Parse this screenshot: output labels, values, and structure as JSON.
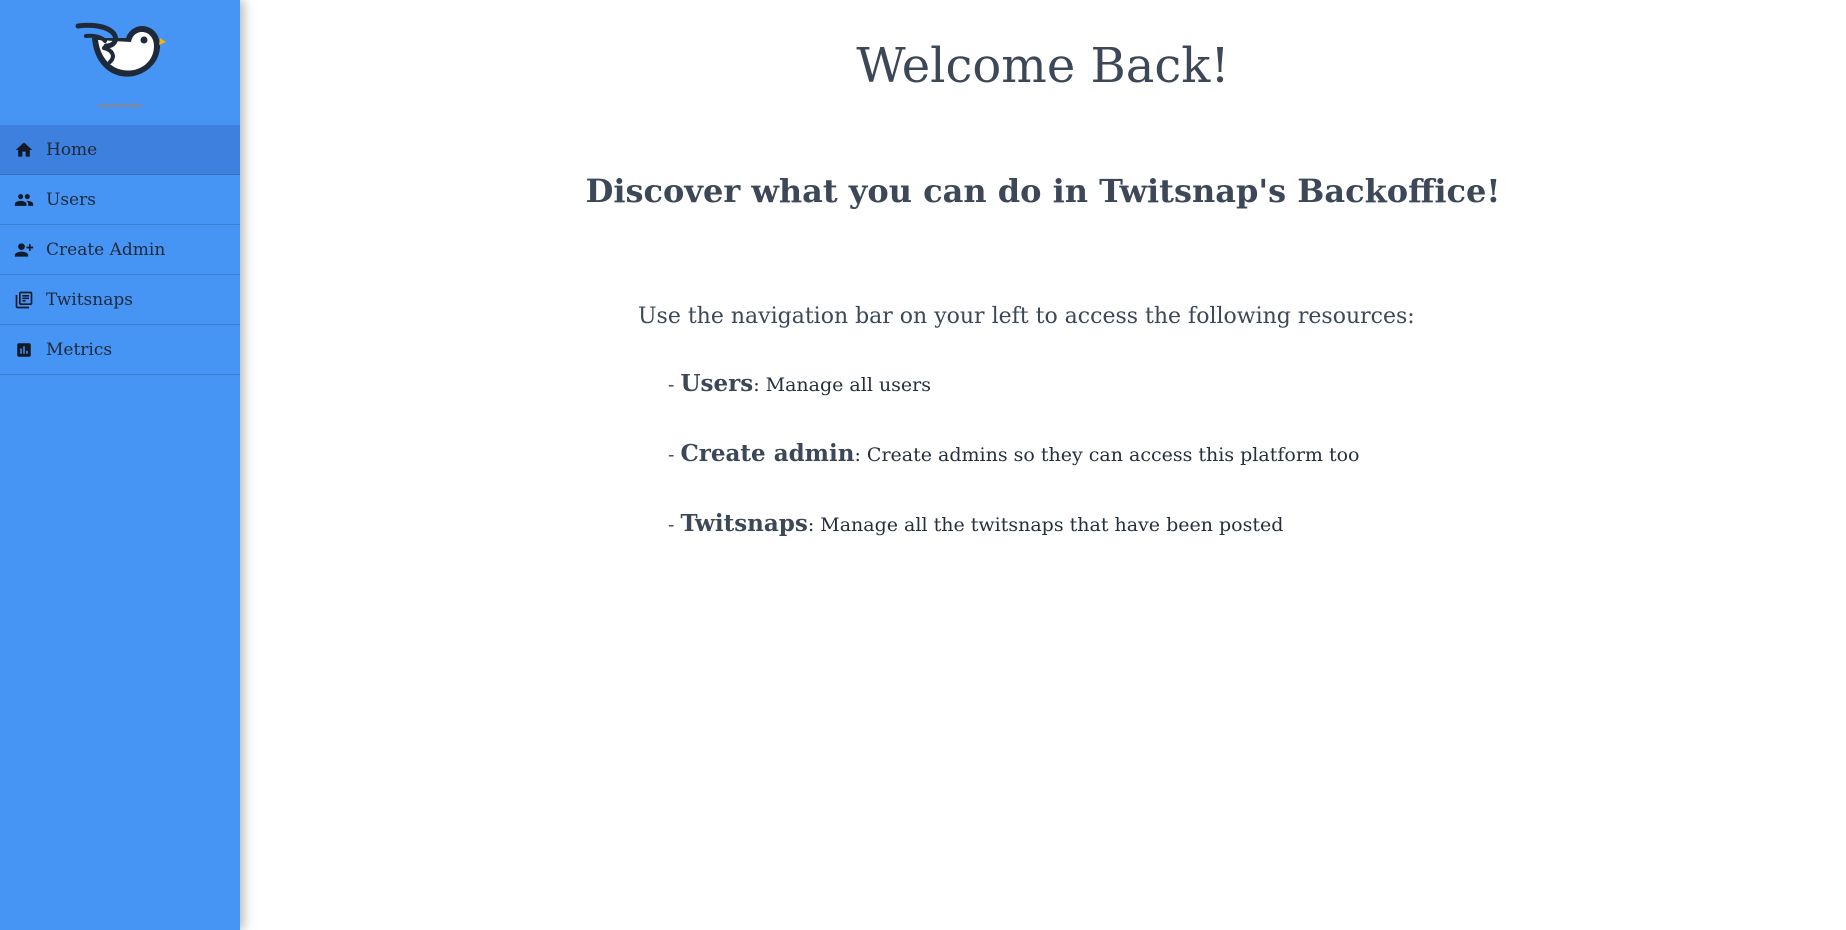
{
  "sidebar": {
    "logo": {
      "icon": "bird-logo-icon"
    },
    "items": [
      {
        "label": "Home",
        "icon": "home-icon",
        "active": true
      },
      {
        "label": "Users",
        "icon": "users-icon",
        "active": false
      },
      {
        "label": "Create Admin",
        "icon": "person-add-icon",
        "active": false
      },
      {
        "label": "Twitsnaps",
        "icon": "collections-icon",
        "active": false
      },
      {
        "label": "Metrics",
        "icon": "bar-chart-icon",
        "active": false
      }
    ]
  },
  "main": {
    "title": "Welcome Back!",
    "subtitle": "Discover what you can do in Twitsnap's Backoffice!",
    "intro": "Use the navigation bar on your left to access the following resources:",
    "resources": [
      {
        "dash": "- ",
        "name": "Users",
        "description": ": Manage all users"
      },
      {
        "dash": "- ",
        "name": "Create admin",
        "description": ": Create admins so they can access this platform too"
      },
      {
        "dash": "- ",
        "name": "Twitsnaps",
        "description": ": Manage all the twitsnaps that have been posted"
      }
    ]
  },
  "colors": {
    "sidebar_bg": "#4694f4",
    "sidebar_active": "#3d80dd",
    "text_heading": "#3c4857",
    "text_body": "#26303d"
  }
}
